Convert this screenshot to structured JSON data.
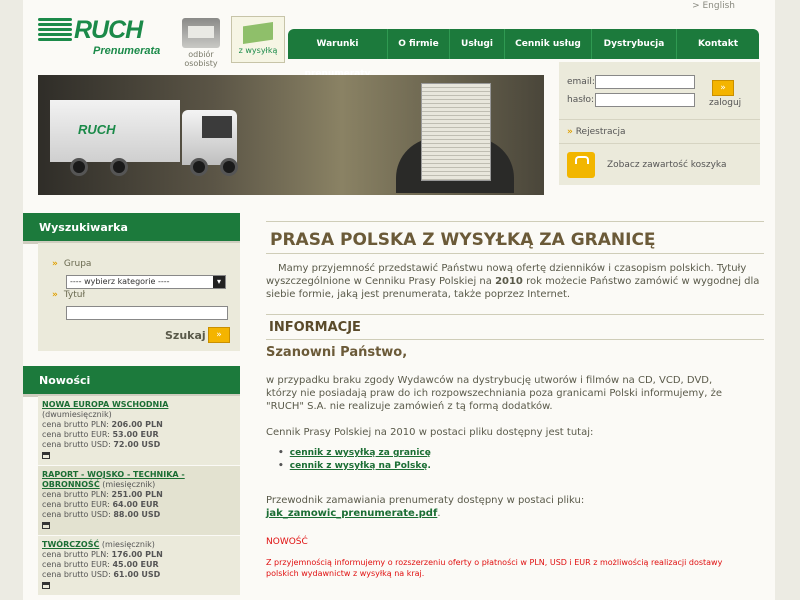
{
  "header": {
    "lang_link": "> English",
    "logo_brand": "RUCH",
    "logo_sub": "Prenumerata",
    "kiosk_label": "odbiór osobisty",
    "mail_label": "z wysyłką"
  },
  "nav": [
    "Warunki prenumeraty",
    "O firmie",
    "Usługi",
    "Cennik usług",
    "Dystrybucja",
    "Kontakt"
  ],
  "login": {
    "email_label": "email:",
    "password_label": "hasło:",
    "login_label": "zaloguj",
    "go": "»",
    "register": "Rejestracja",
    "cart_text": "Zobacz zawartość koszyka"
  },
  "hero": {
    "truck_logo": "RUCH"
  },
  "search": {
    "title": "Wyszukiwarka",
    "group_label": "Grupa",
    "group_value": "---- wybierz kategorie ----",
    "title_label": "Tytuł",
    "submit_label": "Szukaj",
    "go": "»"
  },
  "news_box": {
    "title": "Nowości",
    "items": [
      {
        "title": "NOWA EUROPA WSCHODNIA",
        "period": "(dwumiesięcznik)",
        "pln_label": "cena brutto PLN:",
        "pln": "206.00 PLN",
        "eur_label": "cena brutto EUR:",
        "eur": "53.00 EUR",
        "usd_label": "cena brutto USD:",
        "usd": "72.00 USD"
      },
      {
        "title": "RAPORT - WOJSKO - TECHNIKA - OBRONNOŚĆ",
        "period": "(miesięcznik)",
        "pln_label": "cena brutto PLN:",
        "pln": "251.00 PLN",
        "eur_label": "cena brutto EUR:",
        "eur": "64.00 EUR",
        "usd_label": "cena brutto USD:",
        "usd": "88.00 USD"
      },
      {
        "title": "TWÓRCZOŚĆ",
        "period": "(miesięcznik)",
        "pln_label": "cena brutto PLN:",
        "pln": "176.00 PLN",
        "eur_label": "cena brutto EUR:",
        "eur": "45.00 EUR",
        "usd_label": "cena brutto USD:",
        "usd": "61.00 USD"
      }
    ]
  },
  "main": {
    "title": "PRASA POLSKA Z WYSYŁKĄ ZA GRANICĘ",
    "intro_1": "Mamy przyjemność przedstawić Państwu nową ofertę dzienników i czasopism polskich. Tytuły wyszczególnione w Cenniku Prasy Polskiej na ",
    "intro_year": "2010",
    "intro_2": " rok możecie Państwo zamówić w wygodnej dla siebie formie, jaką jest prenumerata, także poprzez Internet.",
    "info_heading": "INFORMACJE",
    "greeting": "Szanowni Państwo,",
    "para1": "w przypadku braku zgody Wydawców na dystrybucję utworów i filmów na CD, VCD, DVD, którzy nie posiadają praw do ich rozpowszechniania poza granicami Polski informujemy, że \"RUCH\" S.A. nie realizuje zamówień z tą formą dodatków.",
    "para2": "Cennik Prasy Polskiej na 2010 w postaci pliku dostępny jest tutaj:",
    "link1": "cennik z wysyłką za granicę",
    "link2": "cennik z wysyłką na Polskę",
    "link2_suffix": ".",
    "para3": "Przewodnik zamawiania prenumeraty dostępny w postaci pliku: ",
    "pdf_link": "jak_zamowic_prenumerate.pdf",
    "pdf_suffix": ".",
    "news_heading": "NOWOŚĆ",
    "news_text": "Z przyjemnością informujemy o rozszerzeniu oferty o płatności w PLN, USD i EUR z możliwością realizacji dostawy polskich wydawnictw z wysyłką na kraj."
  }
}
